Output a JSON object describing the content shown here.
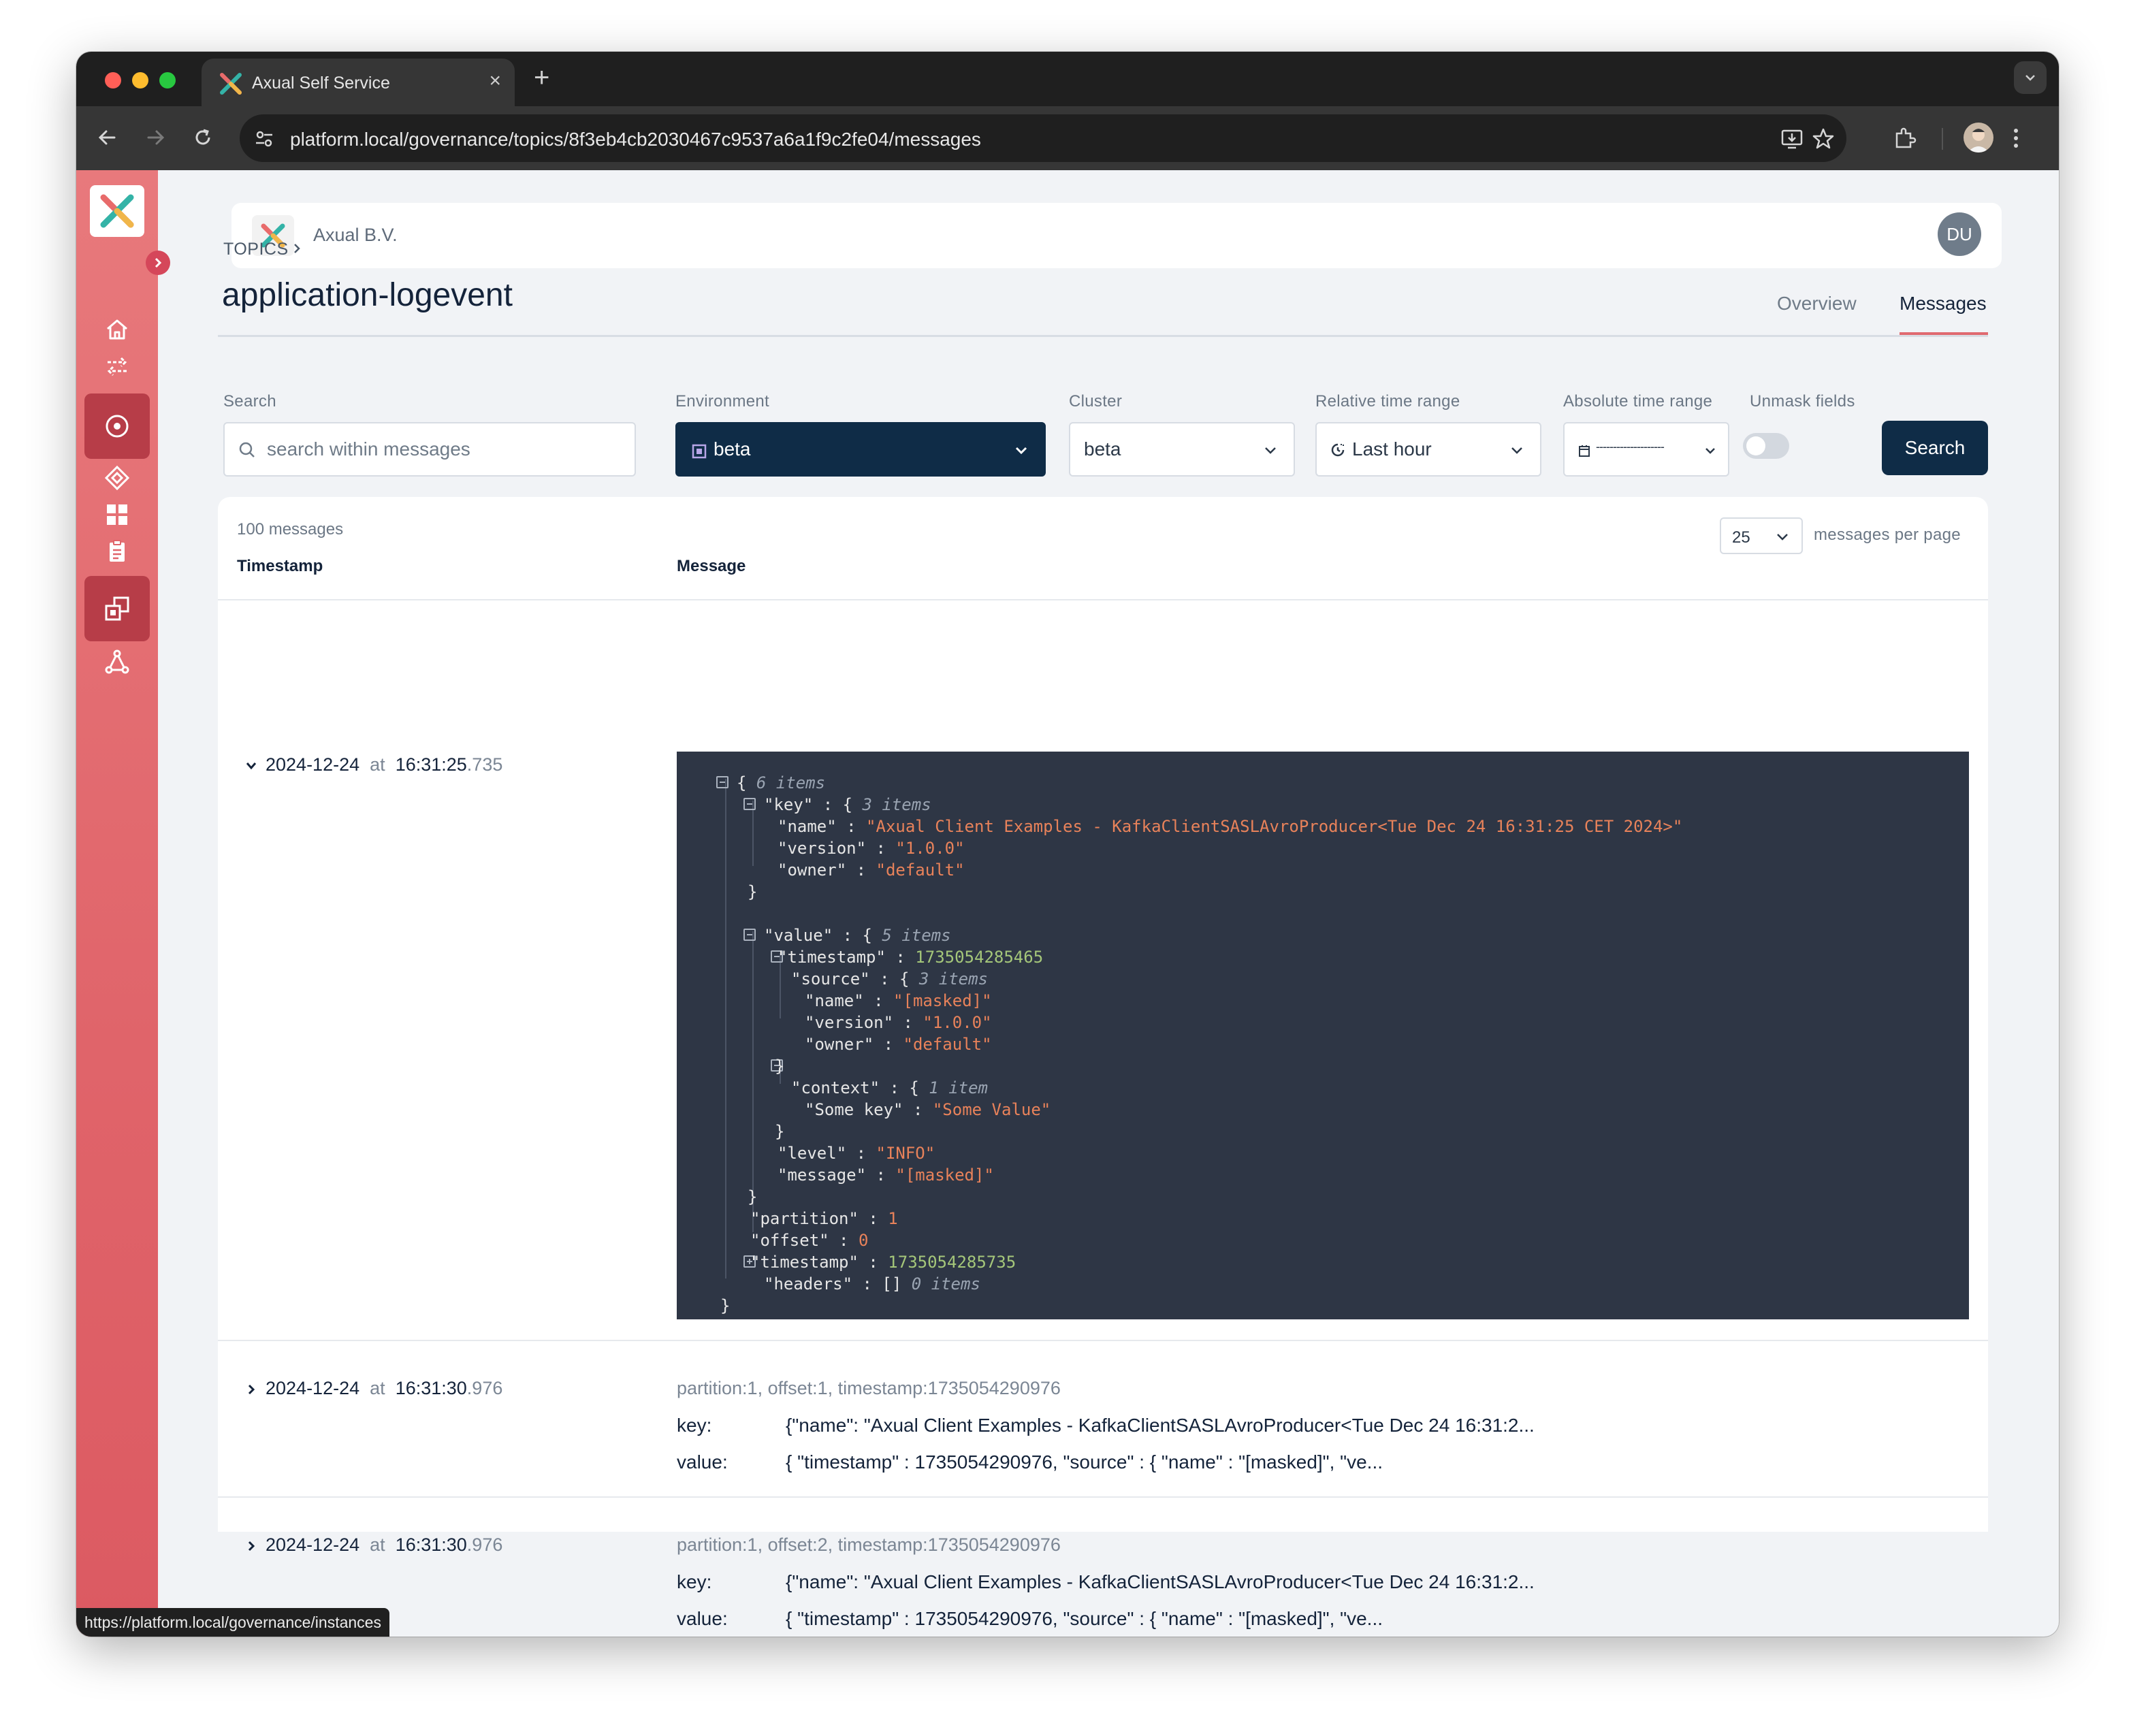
{
  "browser": {
    "tab_title": "Axual Self Service",
    "tab_close": "×",
    "new_tab": "+",
    "url": "platform.local/governance/topics/8f3eb4cb2030467c9537a6a1f9c2fe04/messages",
    "status_url": "https://platform.local/governance/instances"
  },
  "header": {
    "org_name": "Axual B.V.",
    "user_initials": "DU"
  },
  "sidebar": {
    "items": [
      "home",
      "streams",
      "topics",
      "applications",
      "dashboards",
      "clipboard",
      "settings",
      "instances",
      "graph"
    ],
    "active": [
      "topics",
      "instances"
    ]
  },
  "page": {
    "breadcrumb": "TOPICS",
    "title": "application-logevent",
    "tabs": {
      "overview": "Overview",
      "messages": "Messages"
    }
  },
  "filters": {
    "search_label": "Search",
    "search_placeholder": "search within messages",
    "environment_label": "Environment",
    "environment_value": "beta",
    "cluster_label": "Cluster",
    "cluster_value": "beta",
    "relative_label": "Relative time range",
    "relative_value": "Last hour",
    "absolute_label": "Absolute time range",
    "absolute_value": "--------------------",
    "unmask_label": "Unmask fields",
    "search_button": "Search"
  },
  "messages": {
    "count": "100 messages",
    "per_page": "25",
    "per_page_label": "messages per page",
    "col_timestamp": "Timestamp",
    "col_message": "Message",
    "at": "at",
    "key_label": "key:",
    "value_label": "value:",
    "rows": [
      {
        "date": "2024-12-24",
        "time": "16:31:25",
        "ms": ".735"
      },
      {
        "date": "2024-12-24",
        "time": "16:31:30",
        "ms": ".976",
        "meta": "partition:1, offset:1, timestamp:1735054290976",
        "key": "{\"name\": \"Axual Client Examples - KafkaClientSASLAvroProducer<Tue Dec 24 16:31:2...",
        "value": "{ \"timestamp\" : 1735054290976, \"source\" : { \"name\" : \"[masked]\", \"ve..."
      },
      {
        "date": "2024-12-24",
        "time": "16:31:30",
        "ms": ".976",
        "meta": "partition:1, offset:2, timestamp:1735054290976",
        "key": "{\"name\": \"Axual Client Examples - KafkaClientSASLAvroProducer<Tue Dec 24 16:31:2...",
        "value": "{ \"timestamp\" : 1735054290976, \"source\" : { \"name\" : \"[masked]\", \"ve..."
      }
    ]
  },
  "json": {
    "root_count": "6 items",
    "key_count": "3 items",
    "name_val": "\"Axual Client Examples - KafkaClientSASLAvroProducer<Tue Dec 24 16:31:25 CET 2024>\"",
    "version_val": "\"1.0.0\"",
    "owner_val": "\"default\"",
    "value_count": "5 items",
    "timestamp_val": "1735054285465",
    "source_count": "3 items",
    "source_name_val": "\"[masked]\"",
    "source_version_val": "\"1.0.0\"",
    "source_owner_val": "\"default\"",
    "context_count": "1 item",
    "some_key_val": "\"Some Value\"",
    "level_val": "\"INFO\"",
    "message_val": "\"[masked]\"",
    "partition_val": "1",
    "offset_val": "0",
    "outer_timestamp_val": "1735054285735",
    "headers_count": "0 items"
  }
}
